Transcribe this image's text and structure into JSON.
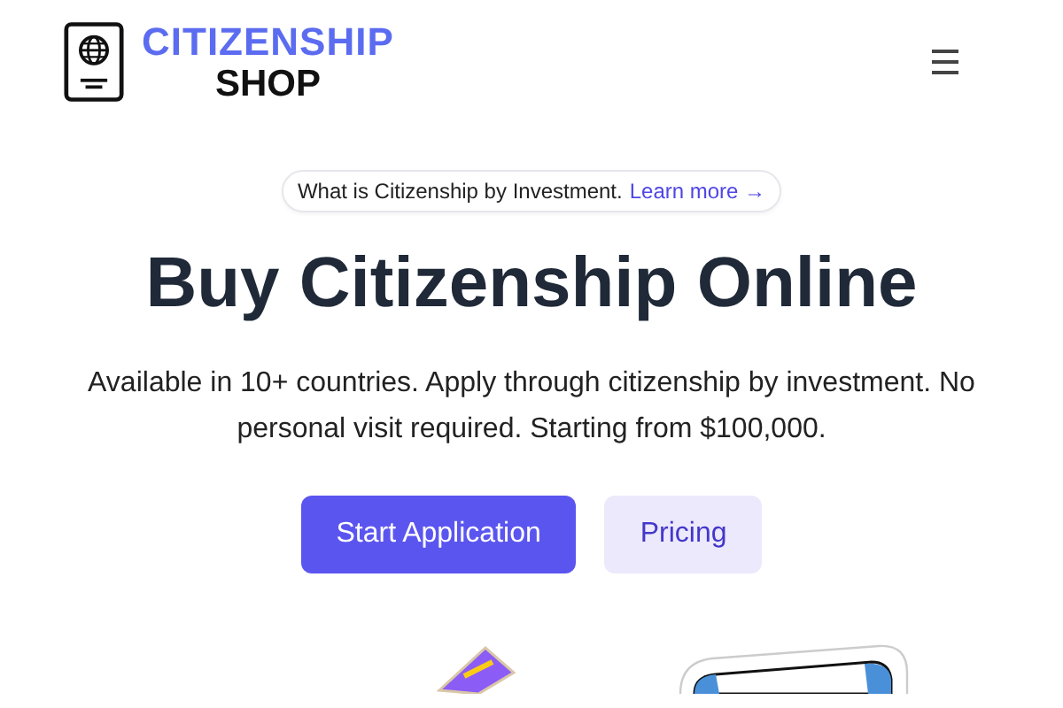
{
  "header": {
    "logo": {
      "line_1": "CITIZENSHIP",
      "line_2": "SHOP"
    }
  },
  "announcement": {
    "text": "What is Citizenship by Investment.",
    "link": "Learn more →"
  },
  "hero": {
    "title": "Buy Citizenship Online",
    "description": "Available in 10+ countries. Apply through citizenship by investment. No personal visit required. Starting from $100,000."
  },
  "buttons": [
    {
      "label": "Start Application",
      "kind": "primary"
    },
    {
      "label": "Pricing",
      "kind": "secondary"
    }
  ]
}
